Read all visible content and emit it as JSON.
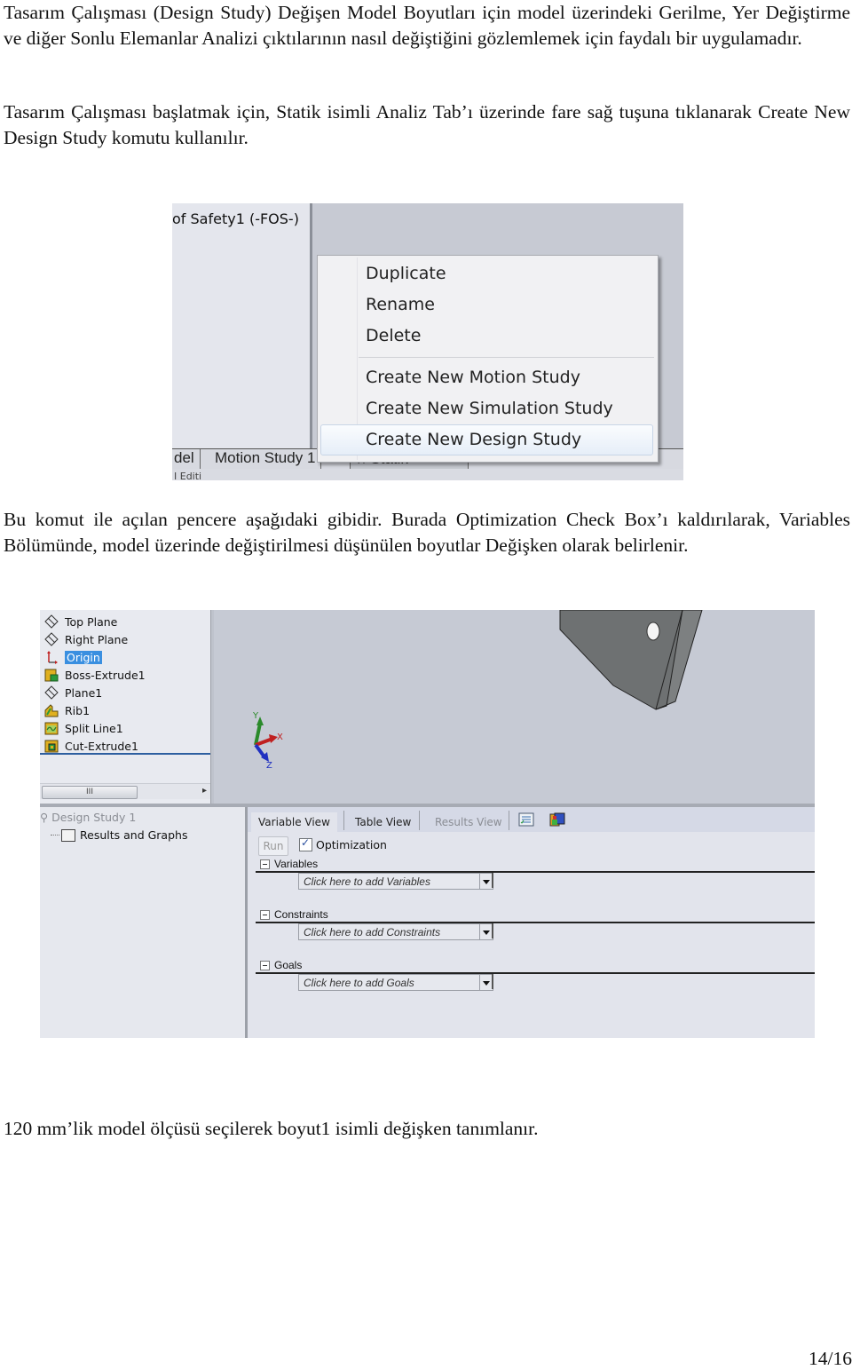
{
  "paragraphs": {
    "intro": "Tasarım Çalışması (Design Study) Değişen Model Boyutları için model üzerindeki Gerilme, Yer Değiştirme ve diğer Sonlu Elemanlar Analizi çıktılarının nasıl değiştiğini gözlemlemek için faydalı bir uygulamadır.",
    "start": "Tasarım Çalışması başlatmak için, Statik isimli Analiz Tab’ı üzerinde fare sağ tuşuna tıklanarak Create New Design Study komutu kullanılır.",
    "window": "Bu komut ile açılan pencere aşağıdaki gibidir. Burada Optimization Check Box’ı kaldırılarak, Variables Bölümünde, model üzerinde değiştirilmesi düşünülen boyutlar Değişken olarak belirlenir.",
    "variable": "120 mm’lik model ölçüsü seçilerek boyut1 isimli değişken tanımlanır."
  },
  "screenshot_context_menu": {
    "tree_item": "of Safety1 (-FOS-)",
    "bottom_tabs": [
      "del",
      "Motion Study 1",
      "Statik"
    ],
    "status_text": "I Editi",
    "menu_items": [
      {
        "label": "Duplicate",
        "group": 1
      },
      {
        "label": "Rename",
        "group": 1
      },
      {
        "label": "Delete",
        "group": 1
      },
      {
        "label": "Create New Motion Study",
        "group": 2
      },
      {
        "label": "Create New Simulation Study",
        "group": 2
      },
      {
        "label": "Create New Design Study",
        "group": 2,
        "highlighted": true
      }
    ]
  },
  "screenshot_design_study": {
    "feature_tree": [
      {
        "label": "Top Plane",
        "icon": "plane-icon"
      },
      {
        "label": "Right Plane",
        "icon": "plane-icon"
      },
      {
        "label": "Origin",
        "icon": "origin-icon",
        "selected": true
      },
      {
        "label": "Boss-Extrude1",
        "icon": "boss-extrude-icon"
      },
      {
        "label": "Plane1",
        "icon": "plane-icon"
      },
      {
        "label": "Rib1",
        "icon": "rib-icon"
      },
      {
        "label": "Split Line1",
        "icon": "split-line-icon"
      },
      {
        "label": "Cut-Extrude1",
        "icon": "cut-extrude-icon"
      }
    ],
    "scroll_thumb": "III",
    "triad_labels": {
      "x": "X",
      "y": "Y",
      "z": "Z"
    },
    "study_tree": {
      "title": "Design Study 1",
      "child": "Results and Graphs"
    },
    "tabs": [
      {
        "label": "Variable View",
        "state": "active"
      },
      {
        "label": "Table View",
        "state": "inactive"
      },
      {
        "label": "Results View",
        "state": "disabled"
      }
    ],
    "run_label": "Run",
    "optimization_label": "Optimization",
    "optimization_checked": true,
    "sections": [
      {
        "title": "Variables",
        "placeholder": "Click here to add Variables"
      },
      {
        "title": "Constraints",
        "placeholder": "Click here to add Constraints"
      },
      {
        "title": "Goals",
        "placeholder": "Click here to add Goals"
      }
    ]
  },
  "footer": {
    "page_number": "14/16"
  }
}
